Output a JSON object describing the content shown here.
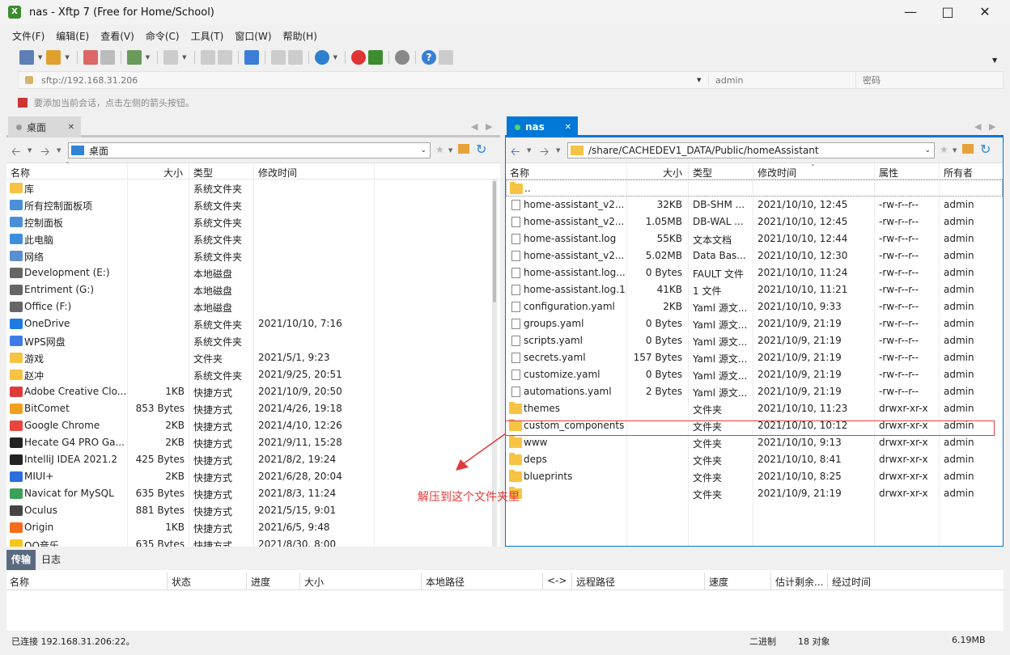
{
  "window": {
    "title": "nas - Xftp 7 (Free for Home/School)",
    "icon": "xftp-app-icon"
  },
  "menu": [
    "文件(F)",
    "编辑(E)",
    "查看(V)",
    "命令(C)",
    "工具(T)",
    "窗口(W)",
    "帮助(H)"
  ],
  "address": {
    "host": "sftp://192.168.31.206",
    "user_placeholder": "admin",
    "password_placeholder": "密码"
  },
  "hint": "要添加当前会话，点击左侧的箭头按钮。",
  "left": {
    "tab": "桌面",
    "path": "桌面",
    "columns": [
      "名称",
      "大小",
      "类型",
      "修改时间"
    ],
    "rows": [
      {
        "name": "库",
        "size": "",
        "type": "系统文件夹",
        "date": "",
        "icon": "library-icon"
      },
      {
        "name": "所有控制面板项",
        "size": "",
        "type": "系统文件夹",
        "date": "",
        "icon": "control-panel-icon"
      },
      {
        "name": "控制面板",
        "size": "",
        "type": "系统文件夹",
        "date": "",
        "icon": "control-panel-icon"
      },
      {
        "name": "此电脑",
        "size": "",
        "type": "系统文件夹",
        "date": "",
        "icon": "computer-icon"
      },
      {
        "name": "网络",
        "size": "",
        "type": "系统文件夹",
        "date": "",
        "icon": "network-icon"
      },
      {
        "name": "Development (E:)",
        "size": "",
        "type": "本地磁盘",
        "date": "",
        "icon": "drive-icon"
      },
      {
        "name": "Entriment (G:)",
        "size": "",
        "type": "本地磁盘",
        "date": "",
        "icon": "drive-icon"
      },
      {
        "name": "Office (F:)",
        "size": "",
        "type": "本地磁盘",
        "date": "",
        "icon": "drive-icon"
      },
      {
        "name": "OneDrive",
        "size": "",
        "type": "系统文件夹",
        "date": "2021/10/10, 7:16",
        "icon": "onedrive-icon"
      },
      {
        "name": "WPS网盘",
        "size": "",
        "type": "系统文件夹",
        "date": "",
        "icon": "wps-cloud-icon"
      },
      {
        "name": "游戏",
        "size": "",
        "type": "文件夹",
        "date": "2021/5/1, 9:23",
        "icon": "folder-icon"
      },
      {
        "name": "赵冲",
        "size": "",
        "type": "系统文件夹",
        "date": "2021/9/25, 20:51",
        "icon": "folder-icon"
      },
      {
        "name": "Adobe Creative Clo...",
        "size": "1KB",
        "type": "快捷方式",
        "date": "2021/10/9, 20:50",
        "icon": "adobe-cc-icon"
      },
      {
        "name": "BitComet",
        "size": "853 Bytes",
        "type": "快捷方式",
        "date": "2021/4/26, 19:18",
        "icon": "bitcomet-icon"
      },
      {
        "name": "Google Chrome",
        "size": "2KB",
        "type": "快捷方式",
        "date": "2021/4/10, 12:26",
        "icon": "chrome-icon"
      },
      {
        "name": "Hecate G4 PRO Ga...",
        "size": "2KB",
        "type": "快捷方式",
        "date": "2021/9/11, 15:28",
        "icon": "hecate-icon"
      },
      {
        "name": "IntelliJ IDEA 2021.2",
        "size": "425 Bytes",
        "type": "快捷方式",
        "date": "2021/8/2, 19:24",
        "icon": "intellij-icon"
      },
      {
        "name": "MIUI+",
        "size": "2KB",
        "type": "快捷方式",
        "date": "2021/6/28, 20:04",
        "icon": "miui-icon"
      },
      {
        "name": "Navicat for MySQL",
        "size": "635 Bytes",
        "type": "快捷方式",
        "date": "2021/8/3, 11:24",
        "icon": "navicat-icon"
      },
      {
        "name": "Oculus",
        "size": "881 Bytes",
        "type": "快捷方式",
        "date": "2021/5/15, 9:01",
        "icon": "oculus-icon"
      },
      {
        "name": "Origin",
        "size": "1KB",
        "type": "快捷方式",
        "date": "2021/6/5, 9:48",
        "icon": "origin-icon"
      },
      {
        "name": "QQ音乐",
        "size": "635 Bytes",
        "type": "快捷方式",
        "date": "2021/8/30, 8:00",
        "icon": "qq-music-icon"
      }
    ]
  },
  "right": {
    "tab": "nas",
    "path": "/share/CACHEDEV1_DATA/Public/homeAssistant",
    "columns": [
      "名称",
      "大小",
      "类型",
      "修改时间",
      "属性",
      "所有者"
    ],
    "rows": [
      {
        "name": "..",
        "size": "",
        "type": "",
        "date": "",
        "attr": "",
        "owner": "",
        "kind": "folder"
      },
      {
        "name": "home-assistant_v2....",
        "size": "32KB",
        "type": "DB-SHM ...",
        "date": "2021/10/10, 12:45",
        "attr": "-rw-r--r--",
        "owner": "admin",
        "kind": "file"
      },
      {
        "name": "home-assistant_v2....",
        "size": "1.05MB",
        "type": "DB-WAL ...",
        "date": "2021/10/10, 12:45",
        "attr": "-rw-r--r--",
        "owner": "admin",
        "kind": "file"
      },
      {
        "name": "home-assistant.log",
        "size": "55KB",
        "type": "文本文档",
        "date": "2021/10/10, 12:44",
        "attr": "-rw-r--r--",
        "owner": "admin",
        "kind": "file"
      },
      {
        "name": "home-assistant_v2....",
        "size": "5.02MB",
        "type": "Data Bas...",
        "date": "2021/10/10, 12:30",
        "attr": "-rw-r--r--",
        "owner": "admin",
        "kind": "file"
      },
      {
        "name": "home-assistant.log....",
        "size": "0 Bytes",
        "type": "FAULT 文件",
        "date": "2021/10/10, 11:24",
        "attr": "-rw-r--r--",
        "owner": "admin",
        "kind": "file"
      },
      {
        "name": "home-assistant.log.1",
        "size": "41KB",
        "type": "1 文件",
        "date": "2021/10/10, 11:21",
        "attr": "-rw-r--r--",
        "owner": "admin",
        "kind": "file"
      },
      {
        "name": "configuration.yaml",
        "size": "2KB",
        "type": "Yaml 源文...",
        "date": "2021/10/10, 9:33",
        "attr": "-rw-r--r--",
        "owner": "admin",
        "kind": "file"
      },
      {
        "name": "groups.yaml",
        "size": "0 Bytes",
        "type": "Yaml 源文...",
        "date": "2021/10/9, 21:19",
        "attr": "-rw-r--r--",
        "owner": "admin",
        "kind": "file"
      },
      {
        "name": "scripts.yaml",
        "size": "0 Bytes",
        "type": "Yaml 源文...",
        "date": "2021/10/9, 21:19",
        "attr": "-rw-r--r--",
        "owner": "admin",
        "kind": "file"
      },
      {
        "name": "secrets.yaml",
        "size": "157 Bytes",
        "type": "Yaml 源文...",
        "date": "2021/10/9, 21:19",
        "attr": "-rw-r--r--",
        "owner": "admin",
        "kind": "file"
      },
      {
        "name": "customize.yaml",
        "size": "0 Bytes",
        "type": "Yaml 源文...",
        "date": "2021/10/9, 21:19",
        "attr": "-rw-r--r--",
        "owner": "admin",
        "kind": "file"
      },
      {
        "name": "automations.yaml",
        "size": "2 Bytes",
        "type": "Yaml 源文...",
        "date": "2021/10/9, 21:19",
        "attr": "-rw-r--r--",
        "owner": "admin",
        "kind": "file"
      },
      {
        "name": "themes",
        "size": "",
        "type": "文件夹",
        "date": "2021/10/10, 11:23",
        "attr": "drwxr-xr-x",
        "owner": "admin",
        "kind": "folder"
      },
      {
        "name": "custom_components",
        "size": "",
        "type": "文件夹",
        "date": "2021/10/10, 10:12",
        "attr": "drwxr-xr-x",
        "owner": "admin",
        "kind": "folder"
      },
      {
        "name": "www",
        "size": "",
        "type": "文件夹",
        "date": "2021/10/10, 9:13",
        "attr": "drwxr-xr-x",
        "owner": "admin",
        "kind": "folder"
      },
      {
        "name": "deps",
        "size": "",
        "type": "文件夹",
        "date": "2021/10/10, 8:41",
        "attr": "drwxr-xr-x",
        "owner": "admin",
        "kind": "folder"
      },
      {
        "name": "blueprints",
        "size": "",
        "type": "文件夹",
        "date": "2021/10/10, 8:25",
        "attr": "drwxr-xr-x",
        "owner": "admin",
        "kind": "folder"
      },
      {
        "name": "",
        "size": "",
        "type": "文件夹",
        "date": "2021/10/9, 21:19",
        "attr": "drwxr-xr-x",
        "owner": "admin",
        "kind": "folder"
      }
    ]
  },
  "annotation": {
    "text": "解压到这个文件夹里",
    "color": "#e03a3a"
  },
  "transfer": {
    "tabs": [
      "传输",
      "日志"
    ],
    "columns": [
      "名称",
      "状态",
      "进度",
      "大小",
      "本地路径",
      "<->",
      "远程路径",
      "速度",
      "估计剩余...",
      "经过时间"
    ]
  },
  "status": {
    "left": "已连接 192.168.31.206:22。",
    "mode": "二进制",
    "count": "18 对象",
    "size": "6.19MB"
  },
  "colors": {
    "accent": "#0078d7",
    "highlight_box": "#e03a3a"
  }
}
